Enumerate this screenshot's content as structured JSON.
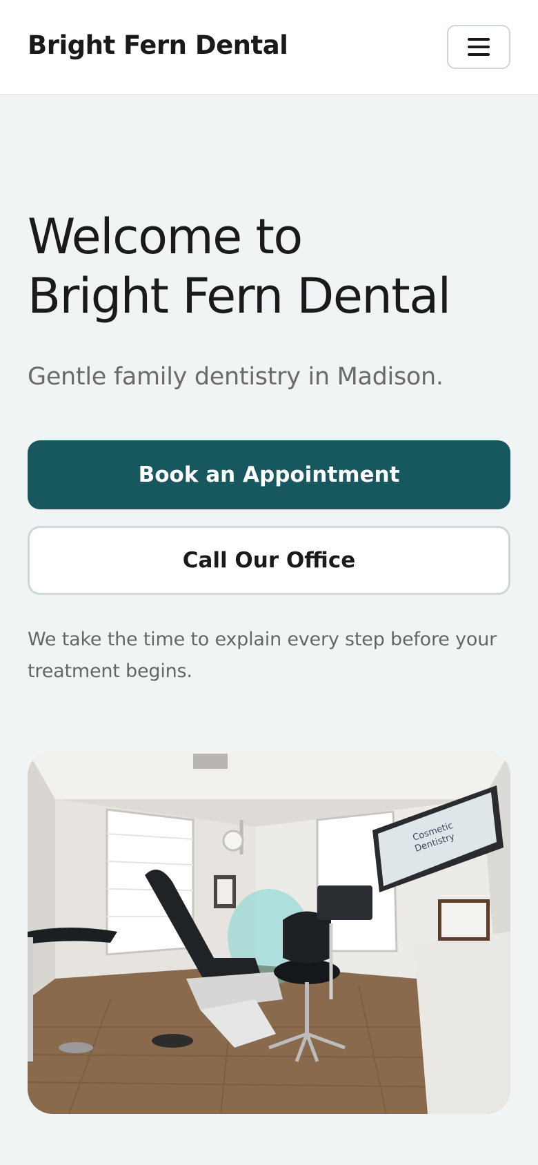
{
  "header": {
    "brand": "Bright Fern Dental",
    "menu_icon": "hamburger-menu-icon"
  },
  "hero": {
    "title_line1": "Welcome to",
    "title_line2": "Bright Fern Dental",
    "tagline": "Gentle family dentistry in Madison.",
    "primary_button": "Book an Appointment",
    "secondary_button": "Call Our Office",
    "intro": "We take the time to explain every step before your treatment begins."
  },
  "photo": {
    "tv_text_line1": "Cosmetic",
    "tv_text_line2": "Dentistry"
  },
  "colors": {
    "accent": "#17585e",
    "background": "#f0f4f4",
    "text": "#1a1a1a",
    "muted_text": "#6b6b6b"
  }
}
